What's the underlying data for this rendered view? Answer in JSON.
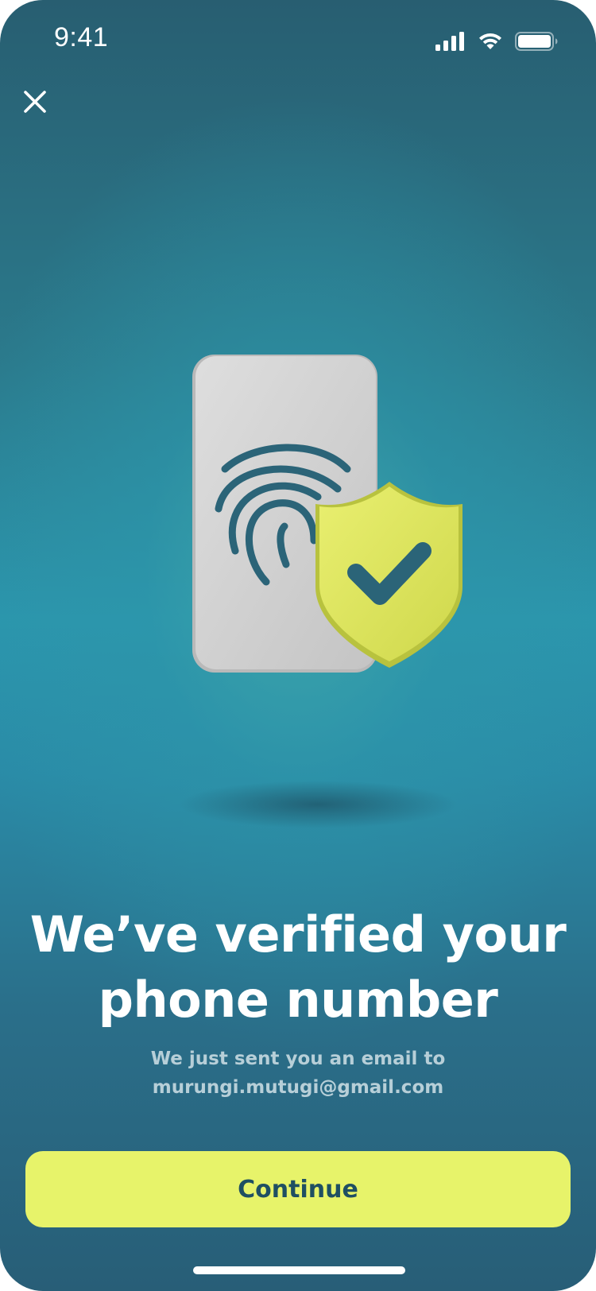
{
  "status_bar": {
    "time": "9:41",
    "icons": [
      "cellular-signal-icon",
      "wifi-icon",
      "battery-icon"
    ]
  },
  "header": {
    "close_icon": "close-icon"
  },
  "illustration": {
    "icons": [
      "phone-icon",
      "fingerprint-icon",
      "shield-check-icon"
    ],
    "colors": {
      "phone": "#cfcfcf",
      "fingerprint": "#2b6478",
      "shield": "#dde55c",
      "check": "#2b6478"
    }
  },
  "content": {
    "title_line1": "We’ve verified your",
    "title_line2": "phone number",
    "subtitle_line1": "We just sent you an email to",
    "subtitle_line2": "murungi.mutugi@gmail.com"
  },
  "actions": {
    "continue_label": "Continue"
  },
  "colors": {
    "accent": "#e7f36a",
    "button_text": "#1f4f62",
    "background_top": "#285e71",
    "background_mid": "#2b96ad"
  }
}
